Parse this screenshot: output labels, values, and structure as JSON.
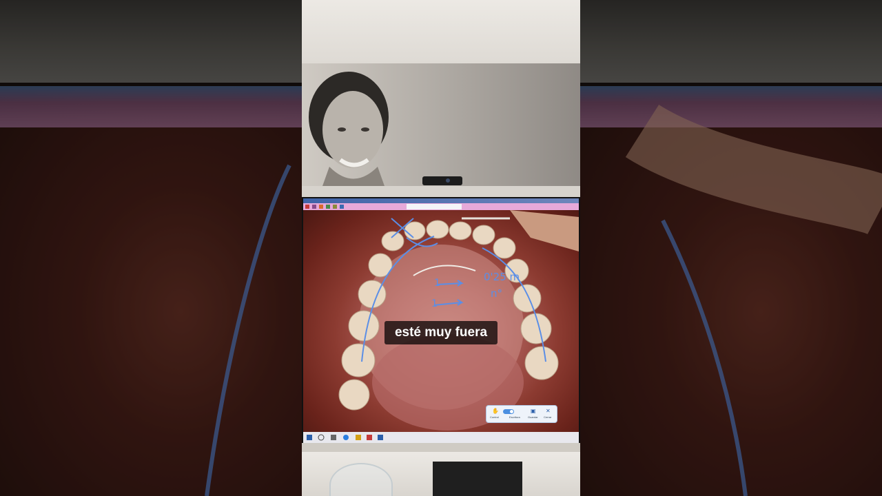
{
  "subtitle": "esté muy fuera",
  "pen_toolbar": {
    "items": [
      {
        "label": "Control",
        "icon": "hand-icon"
      },
      {
        "label": "Escritura",
        "icon": "pen-icon"
      },
      {
        "label": "Guardar",
        "icon": "save-icon"
      },
      {
        "label": "Cerrar",
        "icon": "close-icon"
      }
    ]
  },
  "annotations": {
    "measure_1": "0'25 m",
    "measure_2": "n°",
    "arrow_1": "1",
    "arrow_2": "1"
  },
  "colors": {
    "annotation_ink": "#5b8ee6",
    "caption_bg": "#000000",
    "caption_text": "#ffffff"
  }
}
